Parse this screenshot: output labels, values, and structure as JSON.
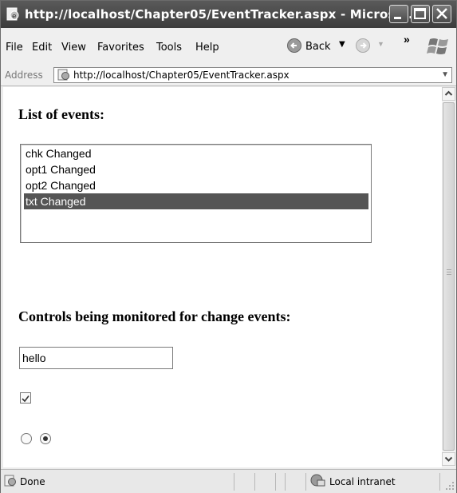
{
  "window": {
    "title": "http://localhost/Chapter05/EventTracker.aspx - Microso...",
    "controls": [
      "minimize",
      "maximize",
      "close"
    ]
  },
  "menu": {
    "file": "File",
    "edit": "Edit",
    "view": "View",
    "favorites": "Favorites",
    "tools": "Tools",
    "help": "Help",
    "back": "Back",
    "more": "»"
  },
  "address": {
    "label": "Address",
    "url": "http://localhost/Chapter05/EventTracker.aspx"
  },
  "page": {
    "events_heading": "List of events:",
    "events": [
      "chk Changed",
      "opt1 Changed",
      "opt2 Changed",
      "txt Changed"
    ],
    "selected_event_index": 3,
    "controls_heading": "Controls being monitored for change events:",
    "textbox_value": "hello",
    "checkbox_checked": true,
    "radio1_selected": false,
    "radio2_selected": true
  },
  "status": {
    "text": "Done",
    "zone": "Local intranet"
  },
  "colors": {
    "titlebar": "#4a4a4a",
    "selection": "#555555"
  }
}
